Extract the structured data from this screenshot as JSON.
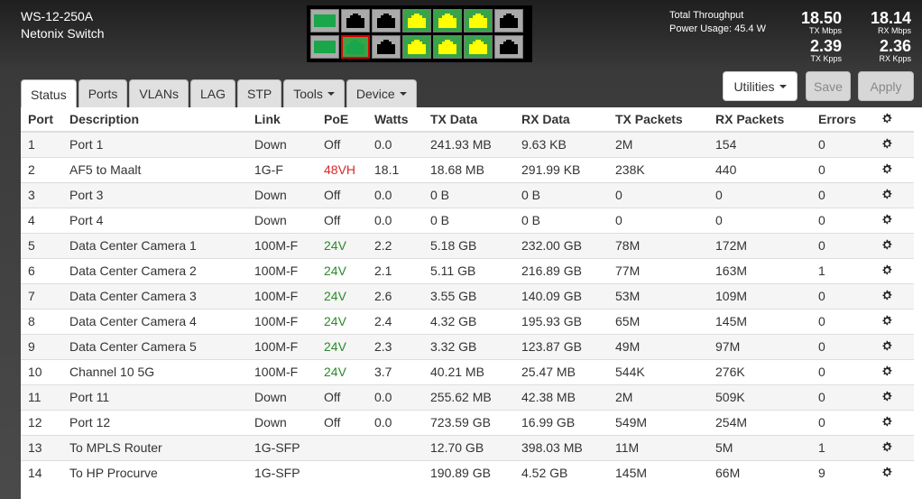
{
  "device": {
    "model": "WS-12-250A",
    "name": "Netonix Switch"
  },
  "throughput": {
    "label": "Total Throughput",
    "power_label": "Power Usage: 45.4 W",
    "tx_mbps": "18.50",
    "tx_mbps_unit": "TX Mbps",
    "rx_mbps": "18.14",
    "rx_mbps_unit": "RX Mbps",
    "tx_kpps": "2.39",
    "tx_kpps_unit": "TX Kpps",
    "rx_kpps": "2.36",
    "rx_kpps_unit": "RX Kpps"
  },
  "buttons": {
    "utilities": "Utilities",
    "save": "Save",
    "apply": "Apply"
  },
  "tabs": [
    "Status",
    "Ports",
    "VLANs",
    "LAG",
    "STP",
    "Tools",
    "Device"
  ],
  "colors": {
    "port_green": "#1aa64a",
    "port_yellow": "#ffff00",
    "port_black": "#000000",
    "poe_green": "#2a8a2a",
    "poe_red": "#d9282a",
    "selected_border": "#dd0000"
  },
  "table": {
    "headers": [
      "Port",
      "Description",
      "Link",
      "PoE",
      "Watts",
      "TX Data",
      "RX Data",
      "TX Packets",
      "RX Packets",
      "Errors"
    ],
    "rows": [
      [
        "1",
        "Port 1",
        "Down",
        "Off",
        "0.0",
        "241.93 MB",
        "9.63 KB",
        "2M",
        "154",
        "0"
      ],
      [
        "2",
        "AF5 to Maalt",
        "1G-F",
        "48VH",
        "18.1",
        "18.68 MB",
        "291.99 KB",
        "238K",
        "440",
        "0"
      ],
      [
        "3",
        "Port 3",
        "Down",
        "Off",
        "0.0",
        "0 B",
        "0 B",
        "0",
        "0",
        "0"
      ],
      [
        "4",
        "Port 4",
        "Down",
        "Off",
        "0.0",
        "0 B",
        "0 B",
        "0",
        "0",
        "0"
      ],
      [
        "5",
        "Data Center Camera 1",
        "100M-F",
        "24V",
        "2.2",
        "5.18 GB",
        "232.00 GB",
        "78M",
        "172M",
        "0"
      ],
      [
        "6",
        "Data Center Camera 2",
        "100M-F",
        "24V",
        "2.1",
        "5.11 GB",
        "216.89 GB",
        "77M",
        "163M",
        "1"
      ],
      [
        "7",
        "Data Center Camera 3",
        "100M-F",
        "24V",
        "2.6",
        "3.55 GB",
        "140.09 GB",
        "53M",
        "109M",
        "0"
      ],
      [
        "8",
        "Data Center Camera 4",
        "100M-F",
        "24V",
        "2.4",
        "4.32 GB",
        "195.93 GB",
        "65M",
        "145M",
        "0"
      ],
      [
        "9",
        "Data Center Camera 5",
        "100M-F",
        "24V",
        "2.3",
        "3.32 GB",
        "123.87 GB",
        "49M",
        "97M",
        "0"
      ],
      [
        "10",
        "Channel 10 5G",
        "100M-F",
        "24V",
        "3.7",
        "40.21 MB",
        "25.47 MB",
        "544K",
        "276K",
        "0"
      ],
      [
        "11",
        "Port 11",
        "Down",
        "Off",
        "0.0",
        "255.62 MB",
        "42.38 MB",
        "2M",
        "509K",
        "0"
      ],
      [
        "12",
        "Port 12",
        "Down",
        "Off",
        "0.0",
        "723.59 GB",
        "16.99 GB",
        "549M",
        "254M",
        "0"
      ],
      [
        "13",
        "To MPLS Router",
        "1G-SFP",
        "",
        "",
        "12.70 GB",
        "398.03 MB",
        "11M",
        "5M",
        "1"
      ],
      [
        "14",
        "To HP Procurve",
        "1G-SFP",
        "",
        "",
        "190.89 GB",
        "4.52 GB",
        "145M",
        "66M",
        "9"
      ]
    ]
  },
  "port_panel": {
    "top": [
      {
        "type": "sfp",
        "color": "green"
      },
      {
        "type": "rj45",
        "color": "black"
      },
      {
        "type": "rj45",
        "color": "black"
      },
      {
        "type": "rj45",
        "color": "yellow"
      },
      {
        "type": "rj45",
        "color": "yellow"
      },
      {
        "type": "rj45",
        "color": "yellow"
      },
      {
        "type": "rj45",
        "color": "black"
      }
    ],
    "bottom": [
      {
        "type": "sfp",
        "color": "green"
      },
      {
        "type": "rj45",
        "color": "green",
        "selected": true
      },
      {
        "type": "rj45",
        "color": "black"
      },
      {
        "type": "rj45",
        "color": "yellow"
      },
      {
        "type": "rj45",
        "color": "yellow"
      },
      {
        "type": "rj45",
        "color": "yellow"
      },
      {
        "type": "rj45",
        "color": "black"
      }
    ]
  }
}
